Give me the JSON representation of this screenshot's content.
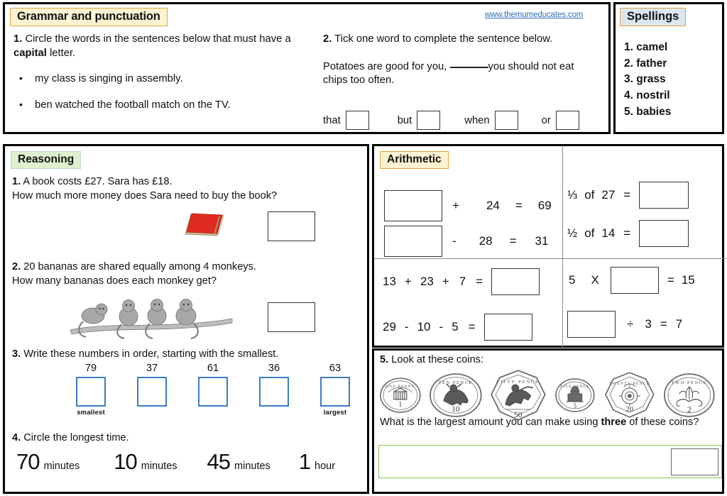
{
  "site_url": "www.themumeducates.com",
  "grammar": {
    "heading": "Grammar and punctuation",
    "q1_text_a": "1.",
    "q1_text_b": " Circle the words in the sentences below that must have a ",
    "q1_bold": "capital",
    "q1_text_c": " letter.",
    "bullets": [
      "my class is singing in assembly.",
      "ben watched the football match on the TV."
    ],
    "q2_num": "2.",
    "q2_text": " Tick one word to complete the sentence below.",
    "q2_sentence_a": "Potatoes are good for you, ",
    "q2_sentence_b": "you should not eat chips too often.",
    "options": [
      "that",
      "but",
      "when",
      "or"
    ]
  },
  "spellings": {
    "heading": "Spellings",
    "words": [
      "1. camel",
      "2. father",
      "3. grass",
      "4. nostril",
      "5. babies"
    ]
  },
  "reasoning": {
    "heading": "Reasoning",
    "q1_num": "1.",
    "q1_line1": " A book costs £27. Sara has £18.",
    "q1_line2": "How much more money does Sara need to buy the book?",
    "q2_num": "2.",
    "q2_line1": " 20 bananas are shared equally among 4 monkeys.",
    "q2_line2": "How many bananas does each monkey get?",
    "q3_num": "3.",
    "q3_text": " Write these numbers in order, starting with the smallest.",
    "q3_numbers": [
      "79",
      "37",
      "61",
      "36",
      "63"
    ],
    "q3_tag_smallest": "smallest",
    "q3_tag_largest": "largest",
    "q4_num": "4.",
    "q4_text": " Circle the longest time.",
    "q4_times": [
      {
        "value": "70",
        "unit": "minutes"
      },
      {
        "value": "10",
        "unit": "minutes"
      },
      {
        "value": "45",
        "unit": "minutes"
      },
      {
        "value": "1",
        "unit": "hour"
      }
    ]
  },
  "arithmetic": {
    "heading": "Arithmetic",
    "equations": [
      {
        "id": "eq1",
        "parts": [
          "[box]",
          "+",
          "24",
          "=",
          "69"
        ]
      },
      {
        "id": "eq2",
        "parts": [
          "[box]",
          "-",
          "28",
          "=",
          "31"
        ]
      },
      {
        "id": "eq3",
        "parts": [
          "⅓",
          "of",
          "27",
          "=",
          "[box]"
        ]
      },
      {
        "id": "eq4",
        "parts": [
          "½",
          "of",
          "14",
          "=",
          "[box]"
        ]
      },
      {
        "id": "eq5",
        "parts": [
          "13",
          "+",
          "23",
          "+",
          "7",
          "=",
          "[box]"
        ]
      },
      {
        "id": "eq6",
        "parts": [
          "29",
          "-",
          "10",
          "-",
          "5",
          "=",
          "[box]"
        ]
      },
      {
        "id": "eq7",
        "parts": [
          "5",
          "X",
          "[box]",
          "=",
          "15"
        ]
      },
      {
        "id": "eq8",
        "parts": [
          "[box]",
          "÷",
          "3",
          "=",
          "7"
        ]
      }
    ],
    "eq1": {
      "a": "+",
      "b": "24",
      "c": "=",
      "d": "69"
    },
    "eq2": {
      "a": "-",
      "b": "28",
      "c": "=",
      "d": "31"
    },
    "eq3": {
      "frac": "⅓",
      "of": "of",
      "num": "27",
      "eq": "="
    },
    "eq4": {
      "frac": "½",
      "of": "of",
      "num": "14",
      "eq": "="
    },
    "eq5": {
      "a": "13",
      "b": "+",
      "c": "23",
      "d": "+",
      "e": "7",
      "f": "="
    },
    "eq6": {
      "a": "29",
      "b": "-",
      "c": "10",
      "d": "-",
      "e": "5",
      "f": "="
    },
    "eq7": {
      "a": "5",
      "b": "X",
      "c": "=",
      "d": "15"
    },
    "eq8": {
      "b": "÷",
      "c": "3",
      "d": "=",
      "e": "7"
    }
  },
  "coins": {
    "q_num": "5.",
    "q_text": " Look at these coins:",
    "list": [
      {
        "name": "one-penny-coin",
        "legend": "ONE PENNY",
        "value": "1"
      },
      {
        "name": "ten-pence-coin",
        "legend": "TEN PENCE",
        "value": "10"
      },
      {
        "name": "fifty-pence-coin",
        "legend": "FIFTY PENCE",
        "value": "50"
      },
      {
        "name": "five-pence-coin",
        "legend": "FIVE PENCE",
        "value": "5"
      },
      {
        "name": "twenty-pence-coin",
        "legend": "TWENTY PENCE",
        "value": "20"
      },
      {
        "name": "two-pence-coin",
        "legend": "TWO PENCE",
        "value": "2"
      }
    ],
    "ask_a": "What is the largest amount you can make using ",
    "ask_bold": "three",
    "ask_b": " of these coins?"
  },
  "colors": {
    "header_cream": "#fdf3d2",
    "header_blue": "#dce6f2",
    "header_green": "#dff0ce",
    "header_border": "#e8a33d",
    "blue_box": "#3b7cc4",
    "green_box": "#86c45a",
    "link": "#2f6fb5",
    "book_red": "#e02b20"
  }
}
